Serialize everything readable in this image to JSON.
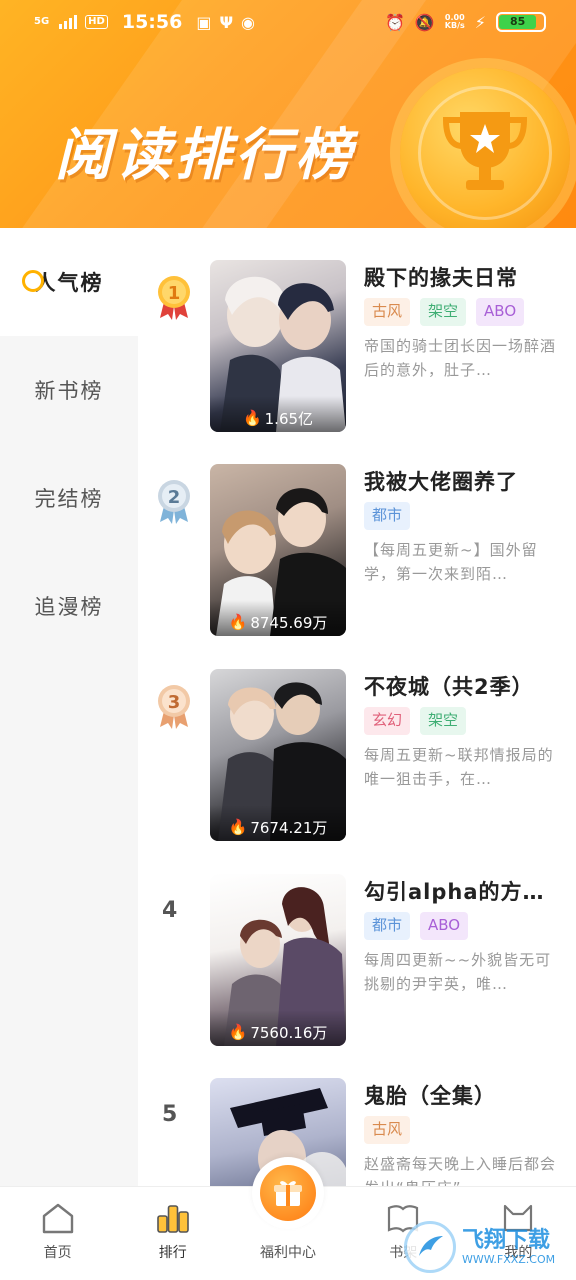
{
  "status_bar": {
    "network": "5G",
    "hd": "HD",
    "time": "15:56",
    "speed_value": "0.00",
    "speed_unit": "KB/s",
    "battery": "85"
  },
  "banner": {
    "title": "阅读排行榜"
  },
  "sidebar": {
    "items": [
      {
        "label": "人气榜",
        "active": true
      },
      {
        "label": "新书榜",
        "active": false
      },
      {
        "label": "完结榜",
        "active": false
      },
      {
        "label": "追漫榜",
        "active": false
      }
    ]
  },
  "list": [
    {
      "rank": "1",
      "title": "殿下的掾夫日常",
      "tags": [
        "古风",
        "架空",
        "ABO"
      ],
      "desc": "帝国的骑士团长因一场醉酒后的意外，肚子…",
      "heat": "1.65亿"
    },
    {
      "rank": "2",
      "title": "我被大佬圈养了",
      "tags": [
        "都市"
      ],
      "desc": "【每周五更新~】国外留学，第一次来到陌…",
      "heat": "8745.69万"
    },
    {
      "rank": "3",
      "title": "不夜城（共2季）",
      "tags": [
        "玄幻",
        "架空"
      ],
      "desc": "每周五更新~联邦情报局的唯一狙击手，在…",
      "heat": "7674.21万"
    },
    {
      "rank": "4",
      "title": "勾引alpha的方…",
      "tags": [
        "都市",
        "ABO"
      ],
      "desc": "每周四更新~~外貌皆无可挑剔的尹宇英，唯…",
      "heat": "7560.16万"
    },
    {
      "rank": "5",
      "title": "鬼胎（全集）",
      "tags": [
        "古风"
      ],
      "desc": "赵盛斋每天晚上入睡后都会发出“鬼压床”",
      "heat": ""
    }
  ],
  "tag_colors": {
    "古风": {
      "bg": "#fdf0e6",
      "fg": "#d98a4e"
    },
    "架空": {
      "bg": "#e7f7ee",
      "fg": "#3fae74"
    },
    "ABO": {
      "bg": "#f3e6fb",
      "fg": "#a85fd6"
    },
    "都市": {
      "bg": "#e8f1fd",
      "fg": "#5b93d8"
    },
    "玄幻": {
      "bg": "#fde8ec",
      "fg": "#e0607a"
    }
  },
  "bottom_nav": {
    "items": [
      {
        "label": "首页",
        "icon": "home-icon"
      },
      {
        "label": "排行",
        "icon": "rank-icon"
      },
      {
        "label": "福利中心",
        "icon": "gift-icon"
      },
      {
        "label": "书架",
        "icon": "bookshelf-icon"
      },
      {
        "label": "我的",
        "icon": "profile-icon"
      }
    ]
  },
  "watermark": {
    "text": "飞翔下载",
    "sub": "WWW.FXXZ.COM"
  },
  "colors": {
    "accent": "#ff9a1a",
    "sidebar_bg": "#f6f6f6"
  }
}
